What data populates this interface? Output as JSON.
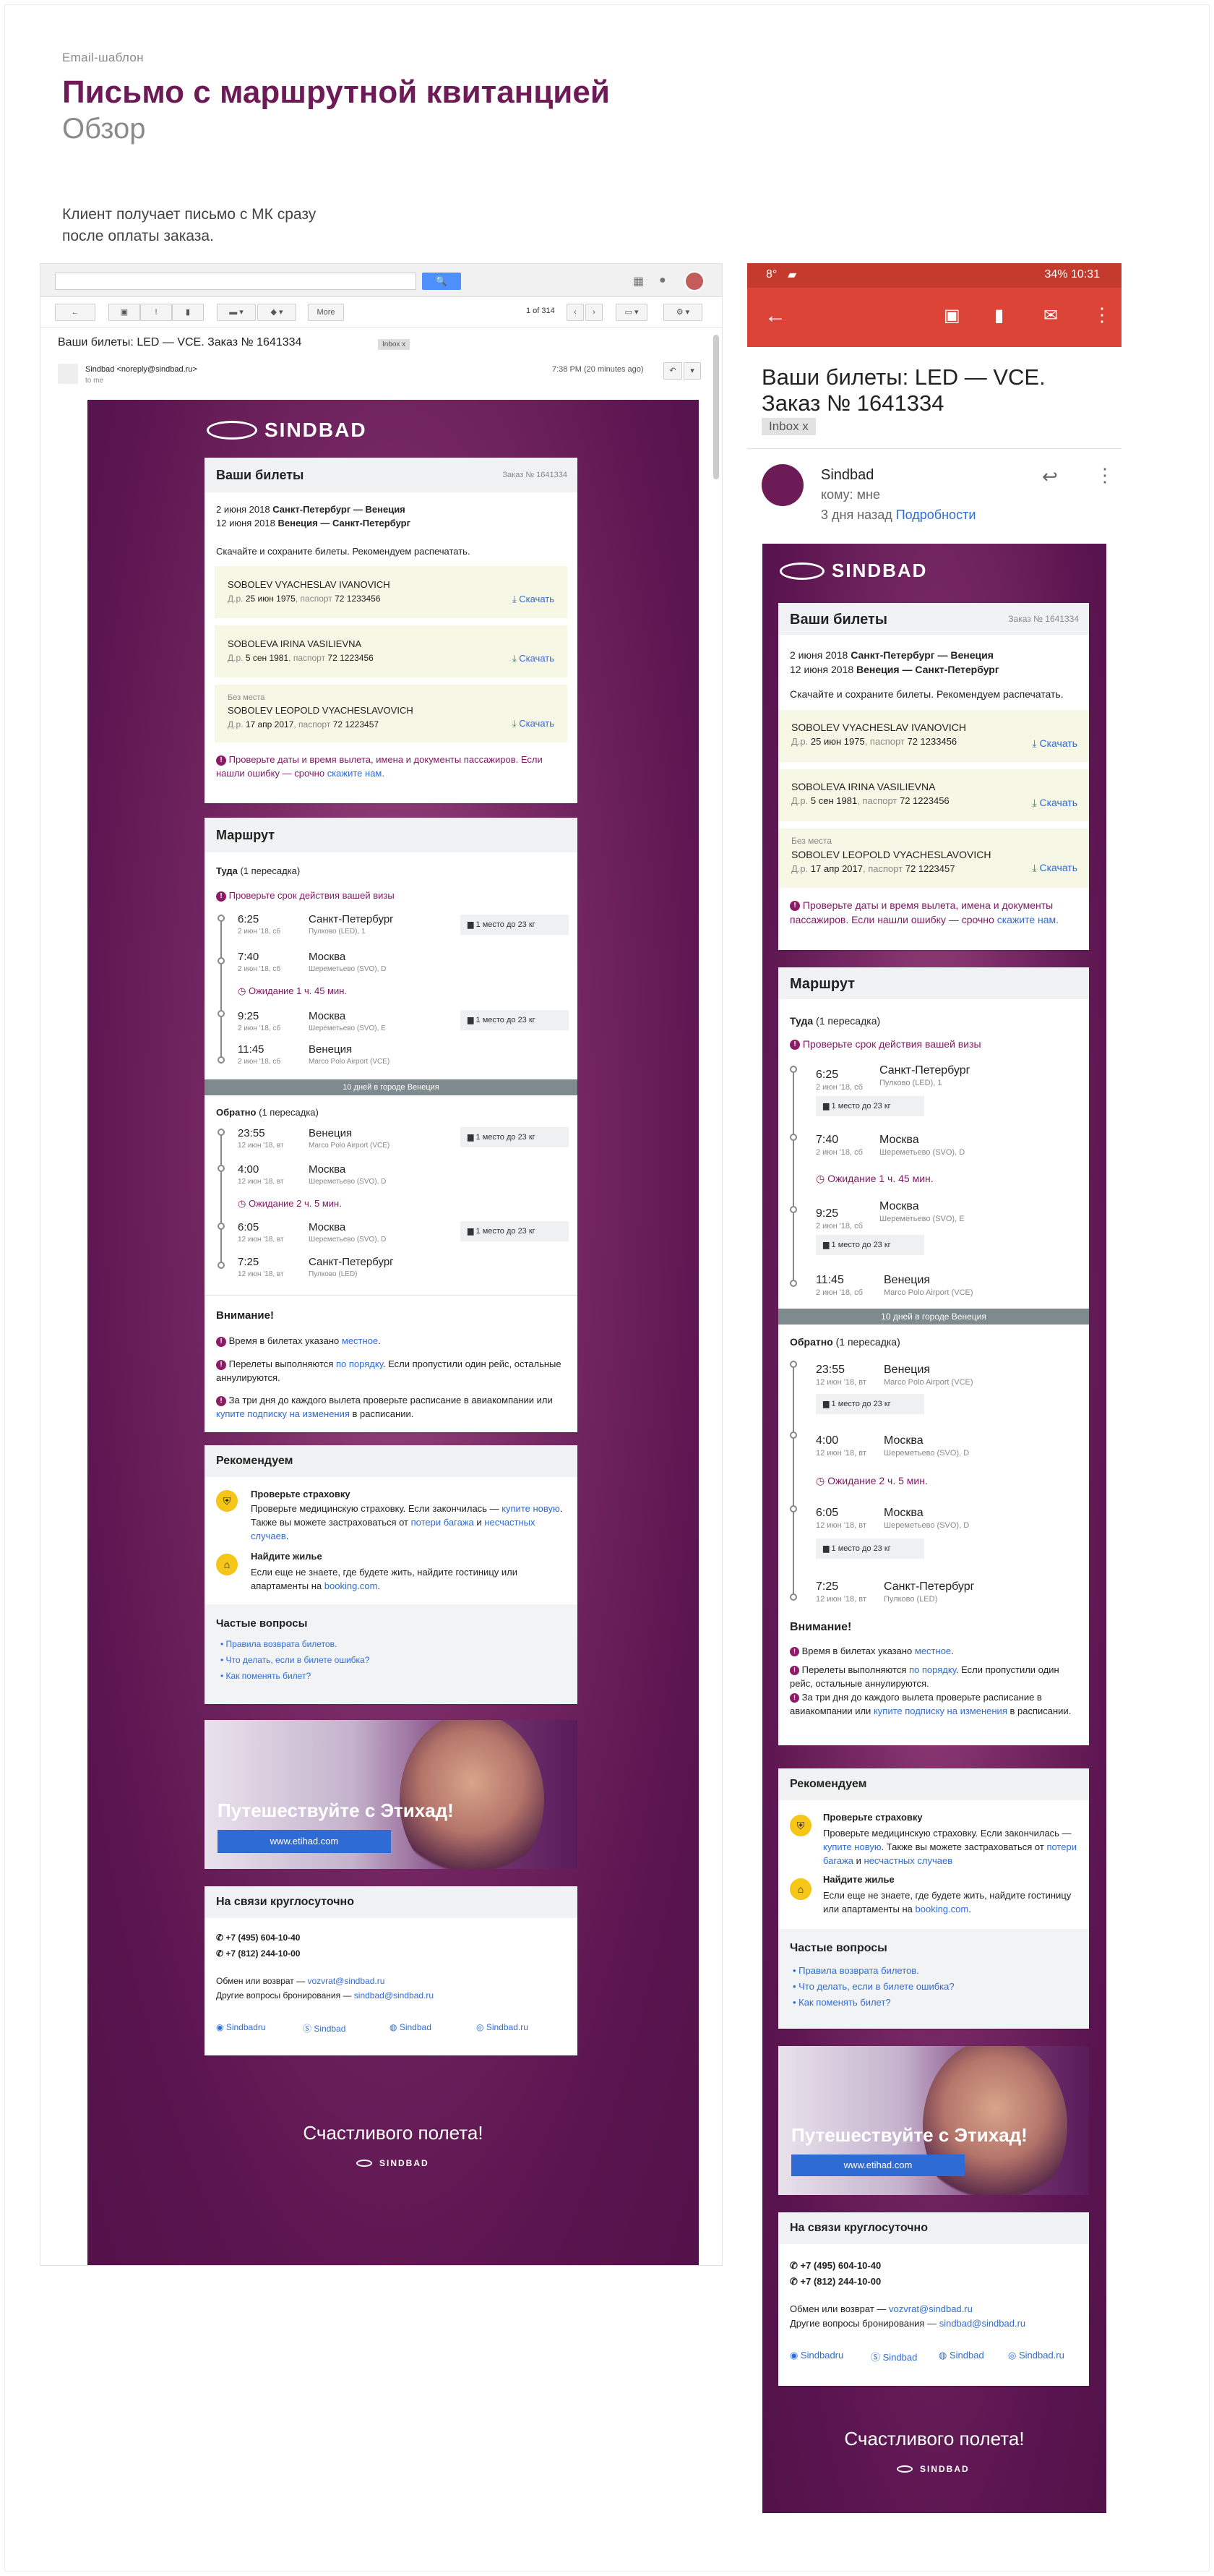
{
  "header": {
    "small": "Email-шаблон",
    "title": "Письмо с маршрутной квитанцией",
    "subtitle": "Обзор",
    "description": "Клиент получает письмо с МК сразу после оплаты заказа."
  },
  "gmail": {
    "search_btn": "🔍",
    "pager": "1 of 314",
    "more_btn": "More",
    "subject": "Ваши билеты: LED — VCE. Заказ № 1641334",
    "inbox_label": "Inbox  x",
    "from": "Sindbad <noreply@sindbad.ru>",
    "to": "to me",
    "date": "7:38 PM (20 minutes ago)"
  },
  "mobile": {
    "status_left": "8°",
    "status_right": "34% 10:31",
    "subject": "Ваши билеты: LED — VCE. Заказ № 1641334",
    "inbox_label": "Inbox  x",
    "sender": "Sindbad",
    "to": "кому: мне",
    "when": "3 дня назад",
    "details": "Подробности"
  },
  "email": {
    "brand": "SINDBAD",
    "tickets": {
      "title": "Ваши билеты",
      "order": "Заказ № 1641334",
      "route1_date": "2 июня 2018",
      "route1": "Санкт-Петербург — Венеция",
      "route2_date": "12 июня 2018",
      "route2": "Венеция — Санкт-Петербург",
      "hint": "Скачайте и сохраните билеты. Рекомендуем распечатать.",
      "download": "Скачать",
      "no_seat": "Без места",
      "dob_label": "Д.р.",
      "passport_label": "паспорт",
      "p1_name": "SOBOLEV VYACHESLAV IVANOVICH",
      "p1_dob": "25 июн 1975",
      "p1_pass": "72 1233456",
      "p2_name": "SOBOLEVA IRINA VASILIEVNA",
      "p2_dob": "5 сен 1981",
      "p2_pass": "72 1223456",
      "p3_name": "SOBOLEV LEOPOLD VYACHESLAVOVICH",
      "p3_dob": "17 апр 2017",
      "p3_pass": "72 1223457",
      "check": "Проверьте даты и время вылета, имена и документы пассажиров. Если нашли ошибку — срочно",
      "check_link": "скажите нам."
    },
    "route": {
      "title": "Маршрут",
      "there": "Туда",
      "there_note": "(1 пересадка)",
      "visa": "Проверьте срок действия вашей визы",
      "t1": "6:25",
      "t1d": "2 июн '18, сб",
      "c1": "Санкт-Петербург",
      "a1": "Пулково (LED), 1",
      "t2": "7:40",
      "t2d": "2 июн '18, сб",
      "c2": "Москва",
      "a2": "Шереметьево (SVO), D",
      "wait1": "Ожидание 1 ч. 45 мин.",
      "t3": "9:25",
      "t3d": "2 июн '18, сб",
      "c3": "Москва",
      "a3": "Шереметьево (SVO), E",
      "t4": "11:45",
      "t4d": "2 июн '18, сб",
      "c4": "Венеция",
      "a4": "Marco Polo Airport (VCE)",
      "bag": "1 место до 23 кг",
      "stay": "10 дней в городе Венеция",
      "back": "Обратно",
      "back_note": "(1 пересадка)",
      "b1": "23:55",
      "b1d": "12 июн '18, вт",
      "bc1": "Венеция",
      "ba1": "Marco Polo Airport (VCE)",
      "b2": "4:00",
      "b2d": "12 июн '18, вт",
      "bc2": "Москва",
      "ba2": "Шереметьево (SVO), D",
      "wait2": "Ожидание 2 ч. 5 мин.",
      "b3": "6:05",
      "b3d": "12 июн '18, вт",
      "bc3": "Москва",
      "ba3": "Шереметьево (SVO), D",
      "b4": "7:25",
      "b4d": "12 июн '18, вт",
      "bc4": "Санкт-Петербург",
      "ba4": "Пулково (LED)"
    },
    "attention": {
      "title": "Внимание!",
      "i1": "Время в билетах указано",
      "i1_link": "местное",
      "i2a": "Перелеты выполняются",
      "i2_link": "по порядку",
      "i2b": ". Если пропустили один рейс, остальные аннулируются.",
      "i3a": "За три дня до каждого вылета проверьте расписание в авиакомпании или",
      "i3_link": "купите подписку на изменения",
      "i3b": "в расписании."
    },
    "recommend": {
      "title": "Рекомендуем",
      "ins_title": "Проверьте страховку",
      "ins_a": "Проверьте медицинскую страховку. Если закончилась —",
      "ins_link1": "купите новую",
      "ins_b": ". Также вы можете застраховаться от",
      "ins_link2": "потери багажа",
      "ins_c": "и",
      "ins_link3": "несчастных случаев",
      "home_title": "Найдите жилье",
      "home_a": "Если еще не знаете, где будете жить, найдите гостиницу или апартаменты на",
      "home_link": "booking.com"
    },
    "faq": {
      "title": "Частые вопросы",
      "q1": "Правила возврата билетов.",
      "q2": "Что делать, если в билете ошибка?",
      "q3": "Как поменять билет?"
    },
    "promo": {
      "text": "Путешествуйте с Этихад!",
      "button": "www.etihad.com"
    },
    "contacts": {
      "title": "На связи круглосуточно",
      "phone1": "+7 (495) 604-10-40",
      "phone2": "+7 (812) 244-10-00",
      "ex_label": "Обмен или возврат —",
      "ex_mail": "vozvrat@sindbad.ru",
      "other_label": "Другие вопросы бронирования —",
      "other_mail": "sindbad@sindbad.ru",
      "s1": "Sindbadru",
      "s2": "Sindbad",
      "s3": "Sindbad",
      "s4": "Sindbad.ru"
    },
    "happy": "Счастливого полета!"
  }
}
